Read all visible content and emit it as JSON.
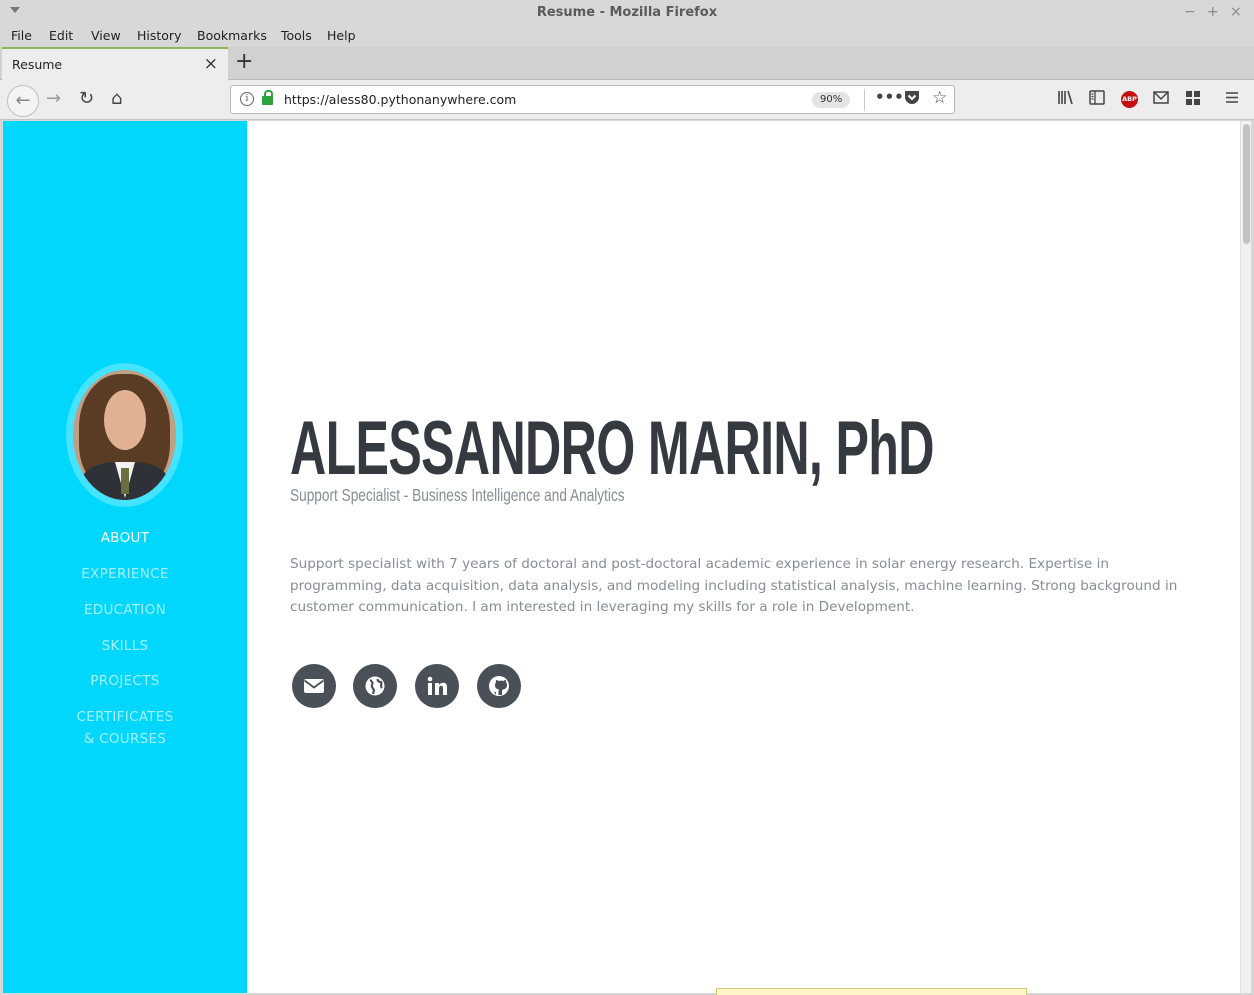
{
  "window": {
    "title": "Resume - Mozilla Firefox"
  },
  "menu": [
    "File",
    "Edit",
    "View",
    "History",
    "Bookmarks",
    "Tools",
    "Help"
  ],
  "tab": {
    "label": "Resume"
  },
  "navbar": {
    "url": "https://aless80.pythonanywhere.com",
    "zoom": "90%"
  },
  "sidebar": {
    "items": [
      {
        "label": "ABOUT",
        "active": true
      },
      {
        "label": "EXPERIENCE",
        "active": false
      },
      {
        "label": "EDUCATION",
        "active": false
      },
      {
        "label": "SKILLS",
        "active": false
      },
      {
        "label": "PROJECTS",
        "active": false
      },
      {
        "label": "CERTIFICATES",
        "active": false
      },
      {
        "label": "& COURSES",
        "active": false
      }
    ]
  },
  "main": {
    "name": "ALESSANDRO MARIN, PhD",
    "subtitle": "Support Specialist - Business Intelligence and Analytics",
    "about": "Support specialist with 7 years of doctoral and post-doctoral academic experience in solar energy research. Expertise in programming, data acquisition, data analysis, and modeling including statistical analysis, machine learning. Strong background in customer communication. I am interested in leveraging my skills for a role in Development.",
    "social": [
      "envelope-icon",
      "globe-icon",
      "linkedin-icon",
      "github-icon"
    ]
  },
  "colors": {
    "sidebar": "#00d7ff",
    "heading": "#343a40",
    "text": "#868e96",
    "social": "#495057"
  }
}
